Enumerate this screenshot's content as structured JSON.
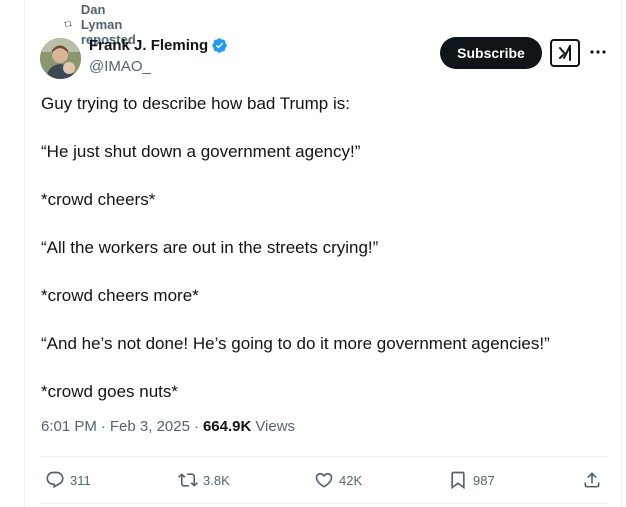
{
  "repost": {
    "text": "Dan Lyman reposted",
    "icon": "repost-icon"
  },
  "author": {
    "name": "Frank J. Fleming",
    "handle": "@IMAO_",
    "verified": true,
    "verified_color": "#1d9bf0"
  },
  "header_actions": {
    "subscribe_label": "Subscribe",
    "grok_icon": "grok-icon",
    "more_icon": "more-icon"
  },
  "tweet": {
    "lines": [
      "Guy trying to describe how bad Trump is:",
      "“He just shut down a government agency!”",
      "*crowd cheers*",
      "“All the workers are out in the streets crying!”",
      "*crowd cheers more*",
      "“And he’s not done! He’s going to do it more government agencies!”",
      "*crowd goes nuts*"
    ]
  },
  "meta": {
    "time": "6:01 PM",
    "date": "Feb 3, 2025",
    "views_count": "664.9K",
    "views_label": "Views",
    "separator": "·"
  },
  "actions": {
    "replies": "311",
    "reposts": "3.8K",
    "likes": "42K",
    "bookmarks": "987"
  },
  "colors": {
    "text": "#0f1419",
    "secondary": "#536471",
    "accent": "#1d9bf0",
    "border": "#eff3f4"
  }
}
